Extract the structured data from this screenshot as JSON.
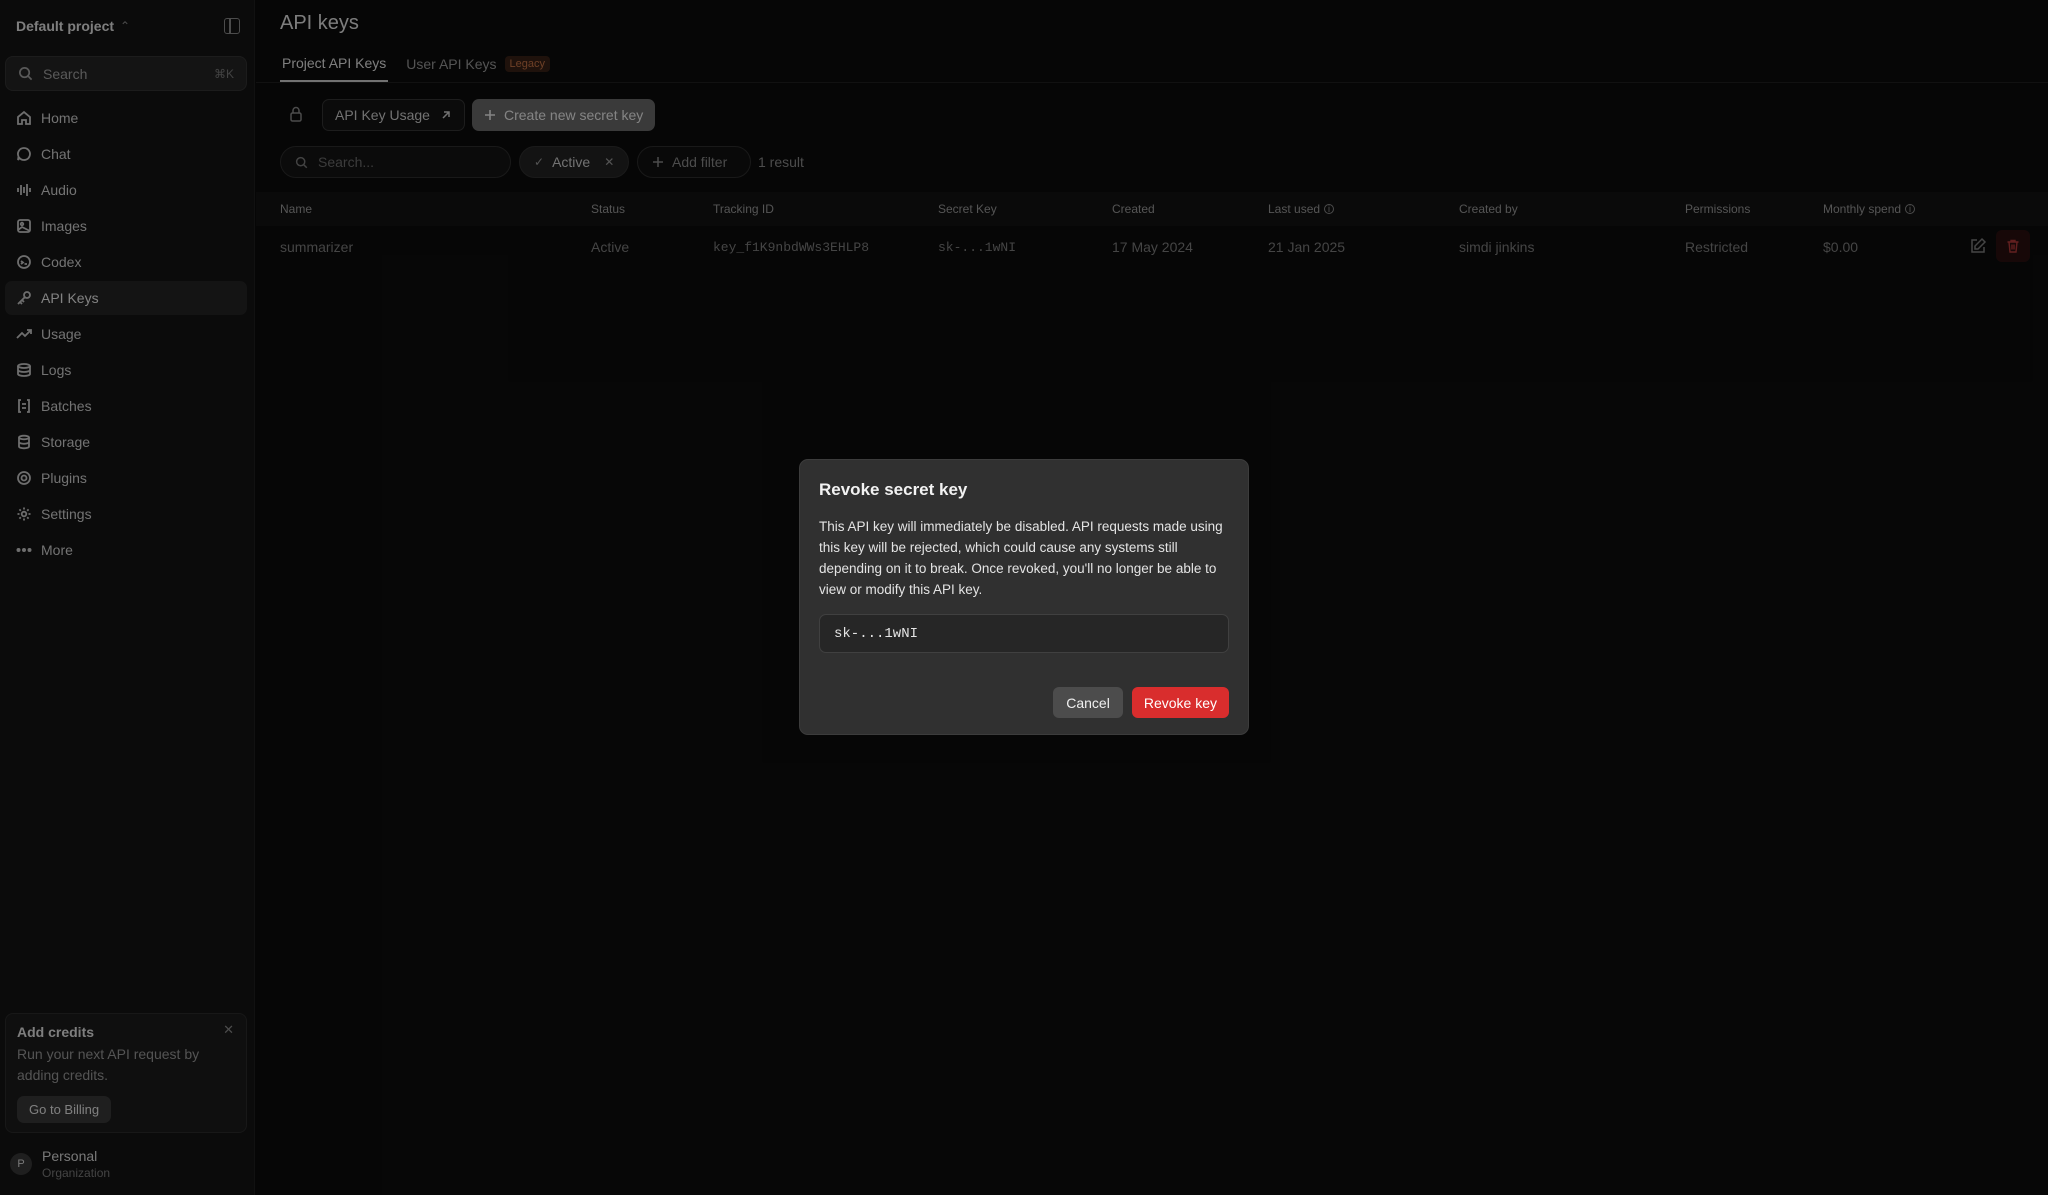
{
  "sidebar": {
    "project": "Default project",
    "search": {
      "label": "Search",
      "shortcut": "⌘K"
    },
    "items": [
      {
        "label": "Home",
        "icon": "home-icon"
      },
      {
        "label": "Chat",
        "icon": "chat-icon"
      },
      {
        "label": "Audio",
        "icon": "audio-icon"
      },
      {
        "label": "Images",
        "icon": "image-icon"
      },
      {
        "label": "Codex",
        "icon": "codex-icon"
      },
      {
        "label": "API Keys",
        "icon": "key-icon"
      },
      {
        "label": "Usage",
        "icon": "usage-icon"
      },
      {
        "label": "Logs",
        "icon": "logs-icon"
      },
      {
        "label": "Batches",
        "icon": "batches-icon"
      },
      {
        "label": "Storage",
        "icon": "storage-icon"
      },
      {
        "label": "Plugins",
        "icon": "plugins-icon"
      },
      {
        "label": "Settings",
        "icon": "gear-icon"
      },
      {
        "label": "More",
        "icon": "more-icon"
      }
    ],
    "active_item": "API Keys",
    "credits": {
      "title": "Add credits",
      "description": "Run your next API request by adding credits.",
      "button": "Go to Billing"
    },
    "org": {
      "avatar": "P",
      "name": "Personal",
      "subtitle": "Organization"
    }
  },
  "header": {
    "title": "API keys",
    "tabs": [
      {
        "label": "Project API Keys",
        "active": true
      },
      {
        "label": "User API Keys",
        "badge": "Legacy"
      }
    ]
  },
  "toolbar": {
    "usage_button": "API Key Usage",
    "create_button": "Create new secret key"
  },
  "filters": {
    "search_placeholder": "Search...",
    "active_chip": "Active",
    "add_filter": "Add filter",
    "result_count": "1 result"
  },
  "table": {
    "columns": [
      "Name",
      "Status",
      "Tracking ID",
      "Secret Key",
      "Created",
      "Last used",
      "Created by",
      "Permissions",
      "Monthly spend"
    ],
    "rows": [
      [
        "summarizer",
        "Active",
        "key_f1K9nbdWWs3EHLP8",
        "sk-...1wNI",
        "17 May 2024",
        "21 Jan 2025",
        "simdi jinkins",
        "Restricted",
        "$0.00"
      ]
    ]
  },
  "modal": {
    "title": "Revoke secret key",
    "body": "This API key will immediately be disabled. API requests made using this key will be rejected, which could cause any systems still depending on it to break. Once revoked, you'll no longer be able to view or modify this API key.",
    "key": "sk-...1wNI",
    "cancel": "Cancel",
    "confirm": "Revoke key"
  },
  "colors": {
    "danger": "#d92d2d",
    "legacy_badge": "#c77446",
    "background": "#0c0c0c"
  }
}
